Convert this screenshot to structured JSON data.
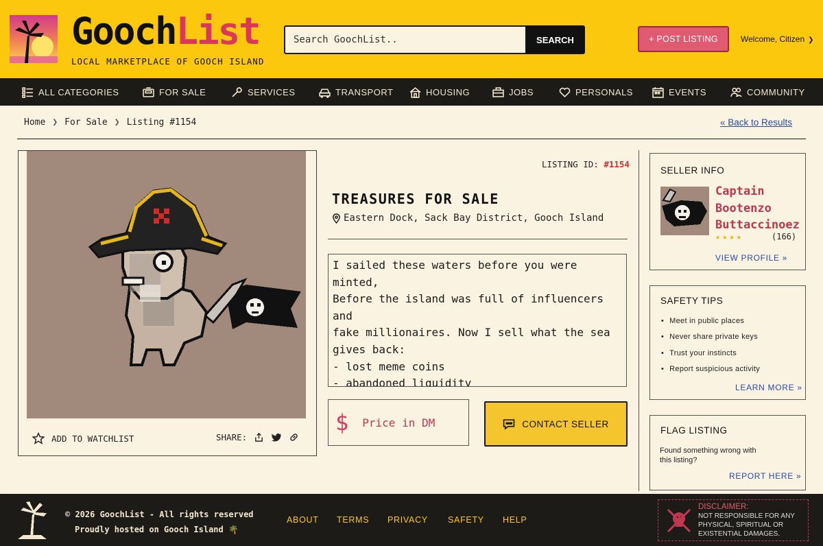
{
  "brand": {
    "name_part1": "Gooch",
    "name_part2": "List",
    "tagline": "LOCAL MARKETPLACE OF GOOCH ISLAND",
    "logo_icon": "palm-sunset-icon"
  },
  "header": {
    "search_placeholder": "Search GoochList..",
    "search_button": "SEARCH",
    "post_button": "+ POST LISTING",
    "welcome": "Welcome, Citizen"
  },
  "nav": {
    "items": [
      {
        "label": "ALL CATEGORIES",
        "icon": "grid-list-icon"
      },
      {
        "label": "FOR SALE",
        "icon": "register-icon"
      },
      {
        "label": "SERVICES",
        "icon": "wrench-icon"
      },
      {
        "label": "TRANSPORT",
        "icon": "car-icon"
      },
      {
        "label": "HOUSING",
        "icon": "house-icon"
      },
      {
        "label": "JOBS",
        "icon": "briefcase-icon"
      },
      {
        "label": "PERSONALS",
        "icon": "heart-icon"
      },
      {
        "label": "EVENTS",
        "icon": "calendar-icon"
      },
      {
        "label": "COMMUNITY",
        "icon": "people-icon"
      }
    ]
  },
  "breadcrumb": {
    "items": [
      "Home",
      "For Sale",
      "Listing #1154"
    ],
    "back_link": "« Back to Results"
  },
  "listing": {
    "id_label": "LISTING ID:",
    "id_value": "#1154",
    "title": "TREASURES FOR SALE",
    "location": "Eastern Dock, Sack Bay District, Gooch Island",
    "description": "I sailed these waters before you were minted,\nBefore the island was full of influencers and\nfake millionaires. Now I sell what the sea\ngives back:\n- lost meme coins\n- abandoned liquidity\n- forgotten seed phrases\n- allegedly recovered cold wallets",
    "price_symbol": "$",
    "price_text": "Price in DM",
    "contact_button": "CONTACT SELLER",
    "watchlist": "ADD TO WATCHLIST",
    "share_label": "SHARE:"
  },
  "seller": {
    "heading": "SELLER INFO",
    "name": "Captain Bootenzo Buttaccinoez",
    "stars": "★★★★",
    "reviews": "(166)",
    "view_profile": "VIEW PROFILE »"
  },
  "safety": {
    "heading": "SAFETY TIPS",
    "tips": [
      "Meet in public places",
      "Never share private keys",
      "Trust your instincts",
      "Report suspicious activity"
    ],
    "learn_more": "LEARN MORE »"
  },
  "flag": {
    "heading": "FLAG LISTING",
    "text": "Found something wrong with this listing?",
    "report": "REPORT HERE »"
  },
  "footer": {
    "copyright": "© 2026 GoochList - All rights reserved",
    "hosted": "Proudly hosted on Gooch Island 🌴",
    "links": [
      "ABOUT",
      "TERMS",
      "PRIVACY",
      "SAFETY",
      "HELP"
    ],
    "disclaimer_title": "DISCLAIMER:",
    "disclaimer_text": "NOT RESPONSIBLE FOR ANY PHYSICAL, SPIRITUAL OR EXISTENTIAL DAMAGES."
  },
  "colors": {
    "header_bg": "#fcc80e",
    "nav_bg": "#1d1b18",
    "accent_pink": "#e05a72",
    "link_blue": "#2a4aa8",
    "page_bg": "#fbf3e1"
  }
}
